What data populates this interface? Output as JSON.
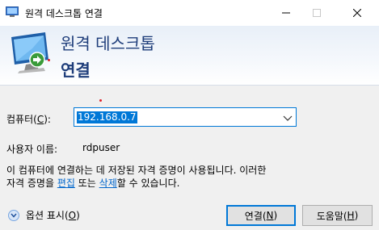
{
  "window": {
    "title": "원격 데스크톱 연결",
    "minimize_icon": "minimize-icon",
    "maximize_icon": "maximize-icon",
    "close_icon": "close-icon"
  },
  "banner": {
    "line1": "원격 데스크톱",
    "line2": "연결",
    "icon": "remote-desktop-monitor-icon"
  },
  "form": {
    "computer_label": "컴퓨터(",
    "computer_label_key": "C",
    "computer_label_end": "):",
    "computer_value": "192.168.0.7",
    "user_label": "사용자 이름:",
    "user_value": "rdpuser"
  },
  "description": {
    "line1": "이 컴퓨터에 연결하는 데 저장된 자격 증명이 사용됩니다. 이러한",
    "line2_pre": "자격 증명을 ",
    "edit_link": "편집",
    "line2_mid": " 또는 ",
    "delete_link": "삭제",
    "line2_post": "할 수 있습니다."
  },
  "footer": {
    "options_label_pre": "옵션 표시(",
    "options_key": "O",
    "options_label_post": ")",
    "connect_pre": "연결(",
    "connect_key": "N",
    "connect_post": ")",
    "help_pre": "도움말(",
    "help_key": "H",
    "help_post": ")"
  },
  "colors": {
    "accent": "#0078d7",
    "banner_text": "#1e3d7a",
    "link": "#0066cc"
  }
}
